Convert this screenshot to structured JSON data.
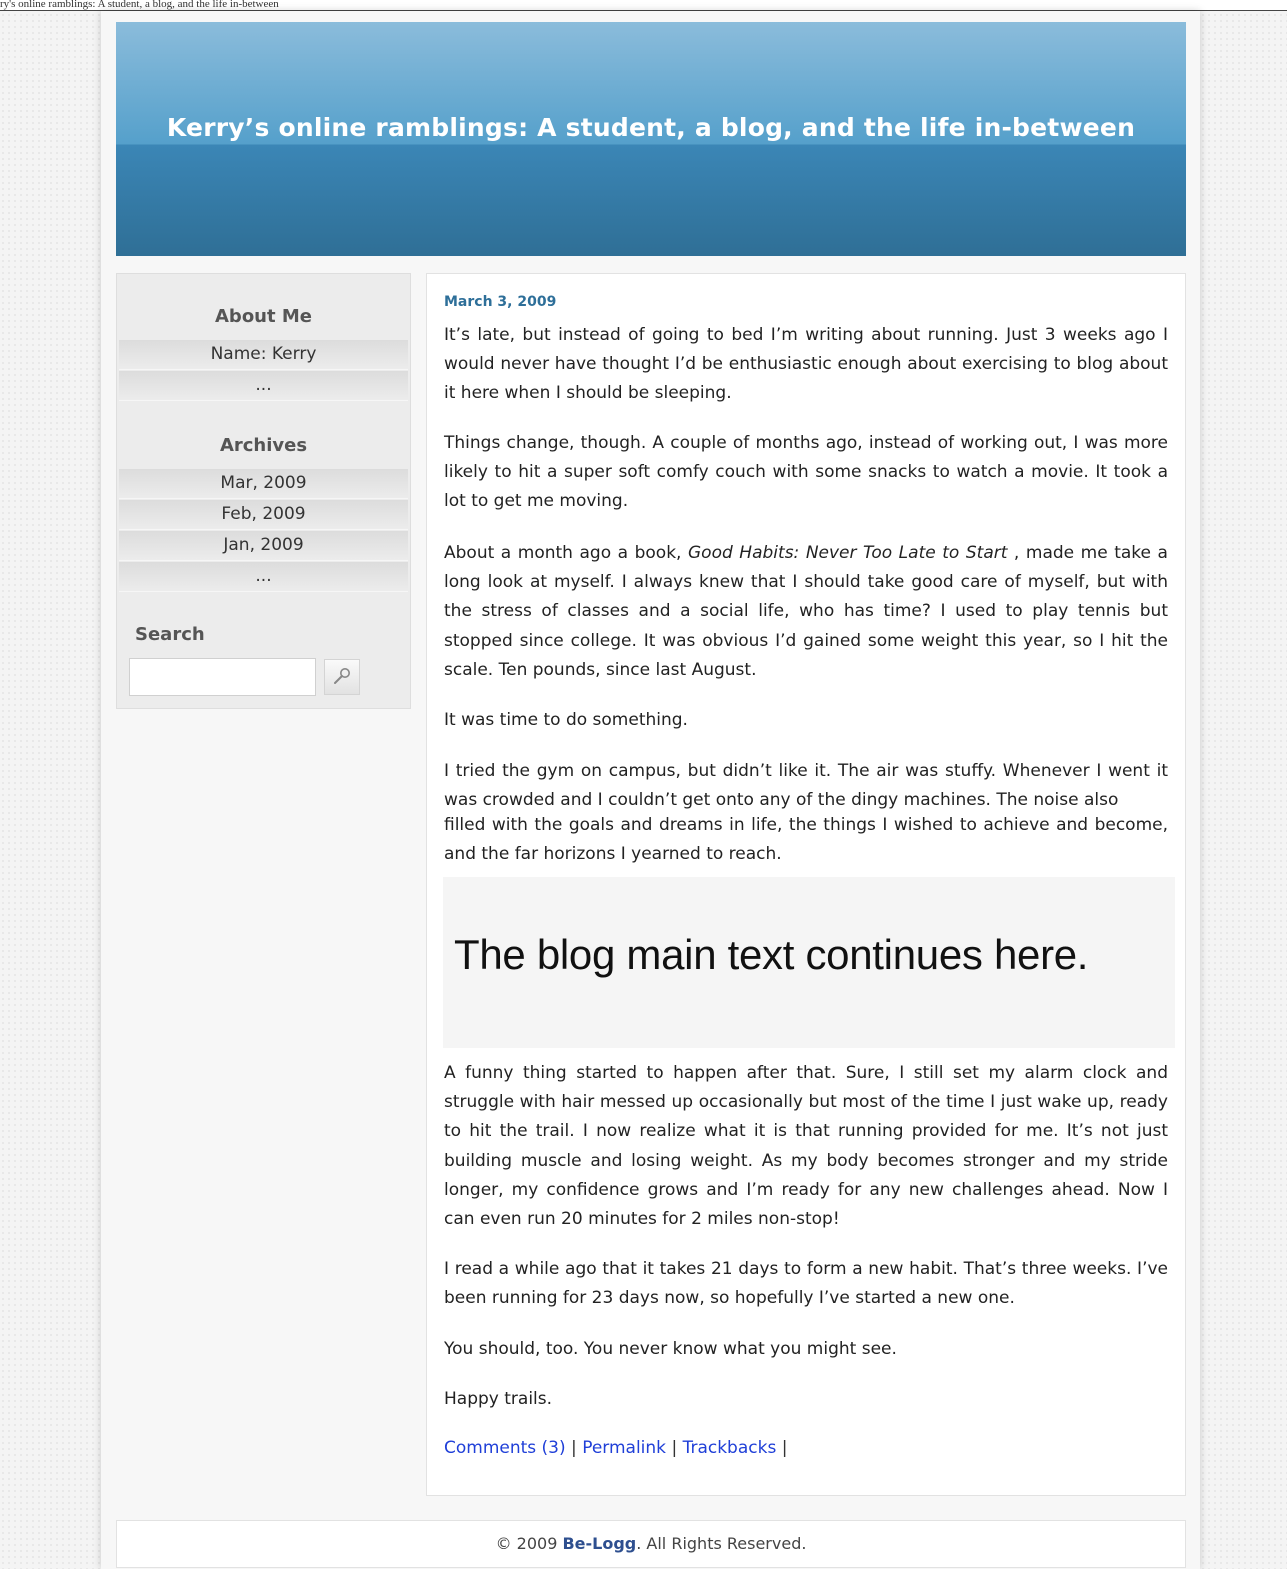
{
  "top_line": "ry's online ramblings: A student, a blog, and the life in-between",
  "blog_title": "Kerry’s online ramblings: A student, a blog, and the life in-between",
  "sidebar": {
    "about_title": "About Me",
    "about_items": [
      "Name: Kerry",
      "..."
    ],
    "archives_title": "Archives",
    "archives_items": [
      "Mar, 2009",
      "Feb, 2009",
      "Jan, 2009",
      "..."
    ],
    "search_title": "Search",
    "search_value": "",
    "search_icon": "search-icon"
  },
  "post": {
    "date": "March 3, 2009",
    "p1": "It’s late, but instead of going to bed I’m writing about running. Just 3 weeks ago I would never have thought I’d be enthusiastic enough about exercising to blog about it here when I should be sleeping.",
    "p2": "Things change, though. A couple of months ago, instead of working out, I was more likely to hit a super soft comfy couch with some snacks to watch a movie. It took a lot to get me moving.",
    "p3_before": "About a month ago a book, ",
    "p3_book": "Good Habits: Never Too Late to Start",
    "p3_after": " , made me take a long look at myself. I always knew that I should take good care of myself, but with the stress of classes and a social life, who has time? I used to play tennis but stopped since college. It was obvious I’d gained some weight this year, so I hit the scale. Ten pounds, since last August.",
    "p4": "It was time to do something.",
    "p5": "I tried the gym on campus, but didn’t like it. The air was stuffy. Whenever I went it was crowded and I couldn’t get onto any of the dingy machines. The noise also",
    "p6": "filled with the goals and dreams in life, the things I wished to achieve and become, and the far horizons I yearned to reach.",
    "continues": "The blog main text continues here.",
    "p7": "A funny thing started to happen after that. Sure, I still set my alarm clock and struggle with hair messed up occasionally but most of the time I just wake up, ready to hit the trail. I now realize what it is that running provided for me. It’s not just building muscle and losing weight. As my body becomes stronger and my stride longer, my confidence grows and I’m ready for any new challenges ahead. Now I can even run 20 minutes for 2 miles non-stop!",
    "p8": "I read a while ago that it takes 21 days to form a new habit. That’s three weeks. I’ve been running for 23 days now, so hopefully I’ve started a new one.",
    "p9": "You should, too. You never know what you might see.",
    "p10": "Happy trails.",
    "links": {
      "comments": "Comments (3)",
      "permalink": "Permalink",
      "trackbacks": "Trackbacks",
      "sep": "|"
    }
  },
  "footer": {
    "prefix": "© 2009 ",
    "brand": "Be-Logg",
    "suffix": ". All Rights Reserved."
  }
}
